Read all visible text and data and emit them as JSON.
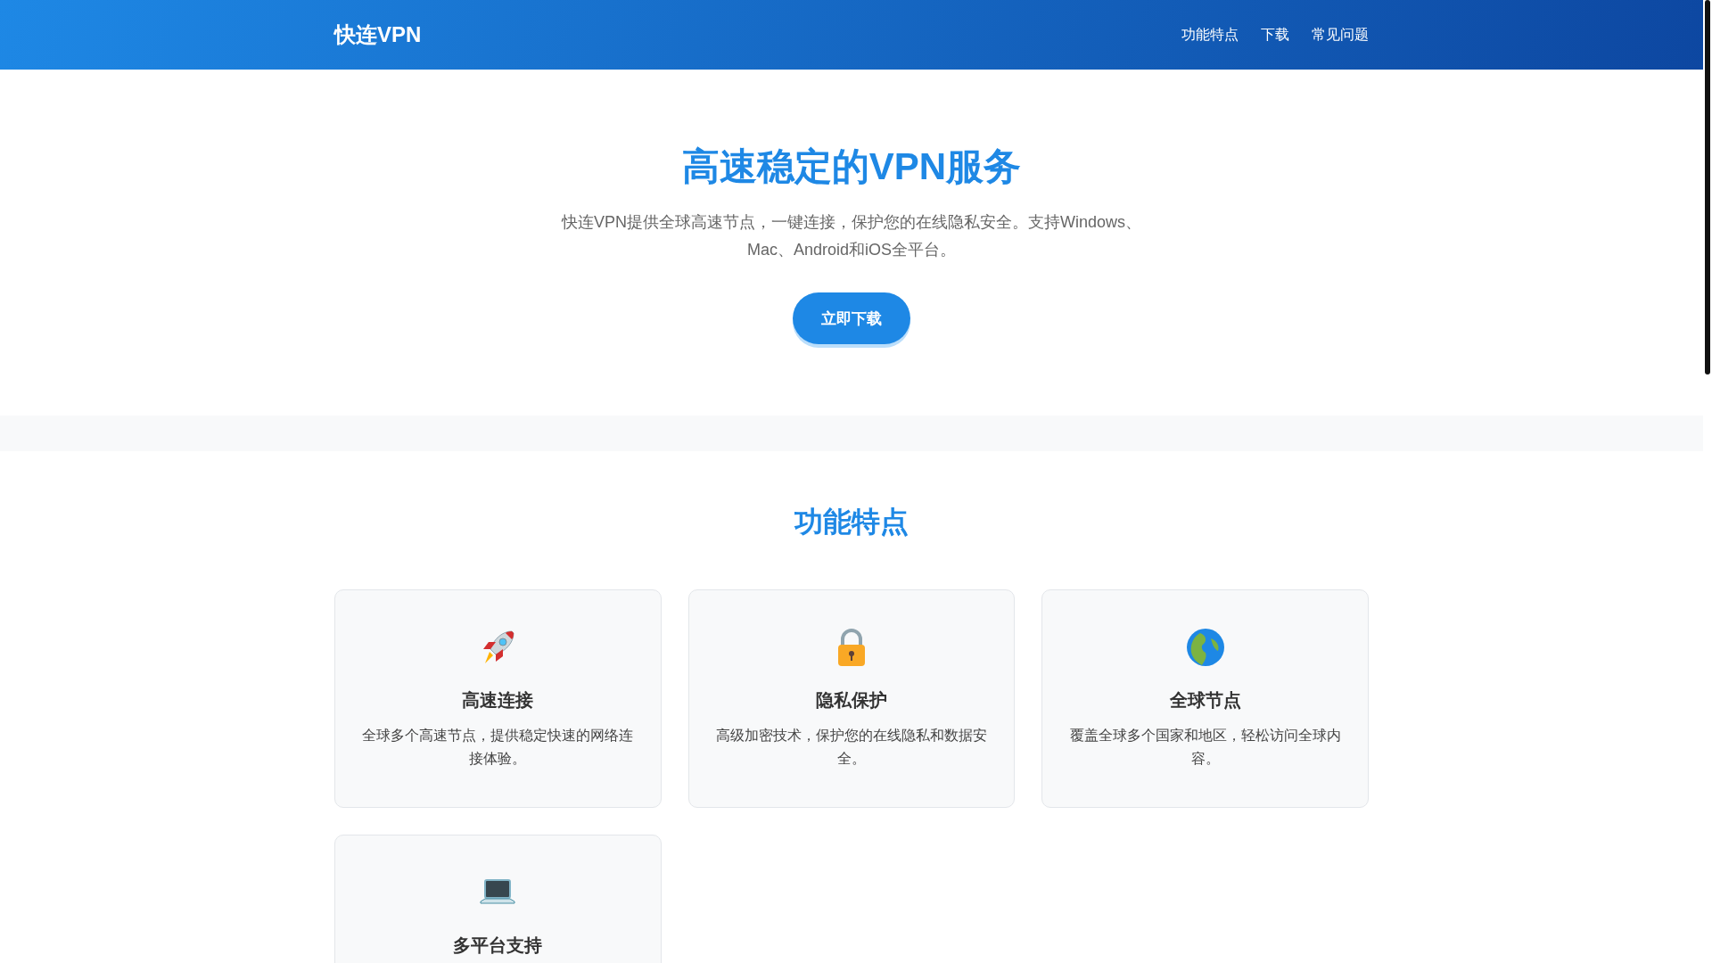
{
  "header": {
    "logo": "快连VPN",
    "nav": [
      "功能特点",
      "下载",
      "常见问题"
    ]
  },
  "hero": {
    "title": "高速稳定的VPN服务",
    "description": "快连VPN提供全球高速节点，一键连接，保护您的在线隐私安全。支持Windows、Mac、Android和iOS全平台。",
    "button": "立即下载"
  },
  "features": {
    "title": "功能特点",
    "cards": [
      {
        "title": "高速连接",
        "description": "全球多个高速节点，提供稳定快速的网络连接体验。"
      },
      {
        "title": "隐私保护",
        "description": "高级加密技术，保护您的在线隐私和数据安全。"
      },
      {
        "title": "全球节点",
        "description": "覆盖全球多个国家和地区，轻松访问全球内容。"
      },
      {
        "title": "多平台支持"
      }
    ]
  }
}
